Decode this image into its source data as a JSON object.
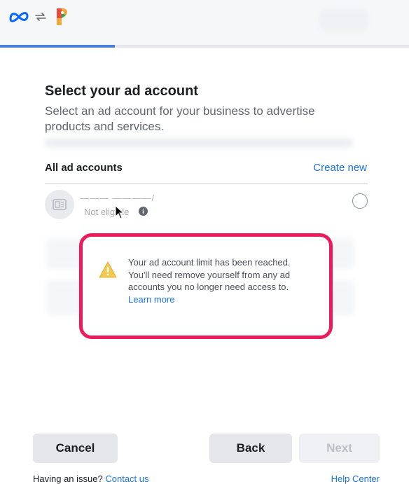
{
  "header": {
    "logo_icon": "meta-logo-icon",
    "sync_icon": "sync-arrows-icon",
    "partner_icon": "partner-app-logo-icon",
    "progress_fraction": 0.28,
    "progress_color": "#4a7fd6"
  },
  "main": {
    "title": "Select your ad account",
    "subtitle": "Select an ad account for your business to advertise products and services.",
    "section_label": "All ad accounts",
    "create_link": "Create new"
  },
  "account": {
    "name": "——— ————/",
    "status": "Not eligible",
    "status_icon": "info-icon"
  },
  "alert": {
    "icon": "warning-icon",
    "message": "Your ad account limit has been reached. You'll need remove yourself from any ad accounts you no longer need access to.",
    "link": "Learn more",
    "border_color": "#ee1b5c"
  },
  "buttons": {
    "cancel": "Cancel",
    "back": "Back",
    "next": "Next"
  },
  "footer": {
    "issue_text": "Having an issue?",
    "contact_link": "Contact us",
    "help_link": "Help Center"
  }
}
